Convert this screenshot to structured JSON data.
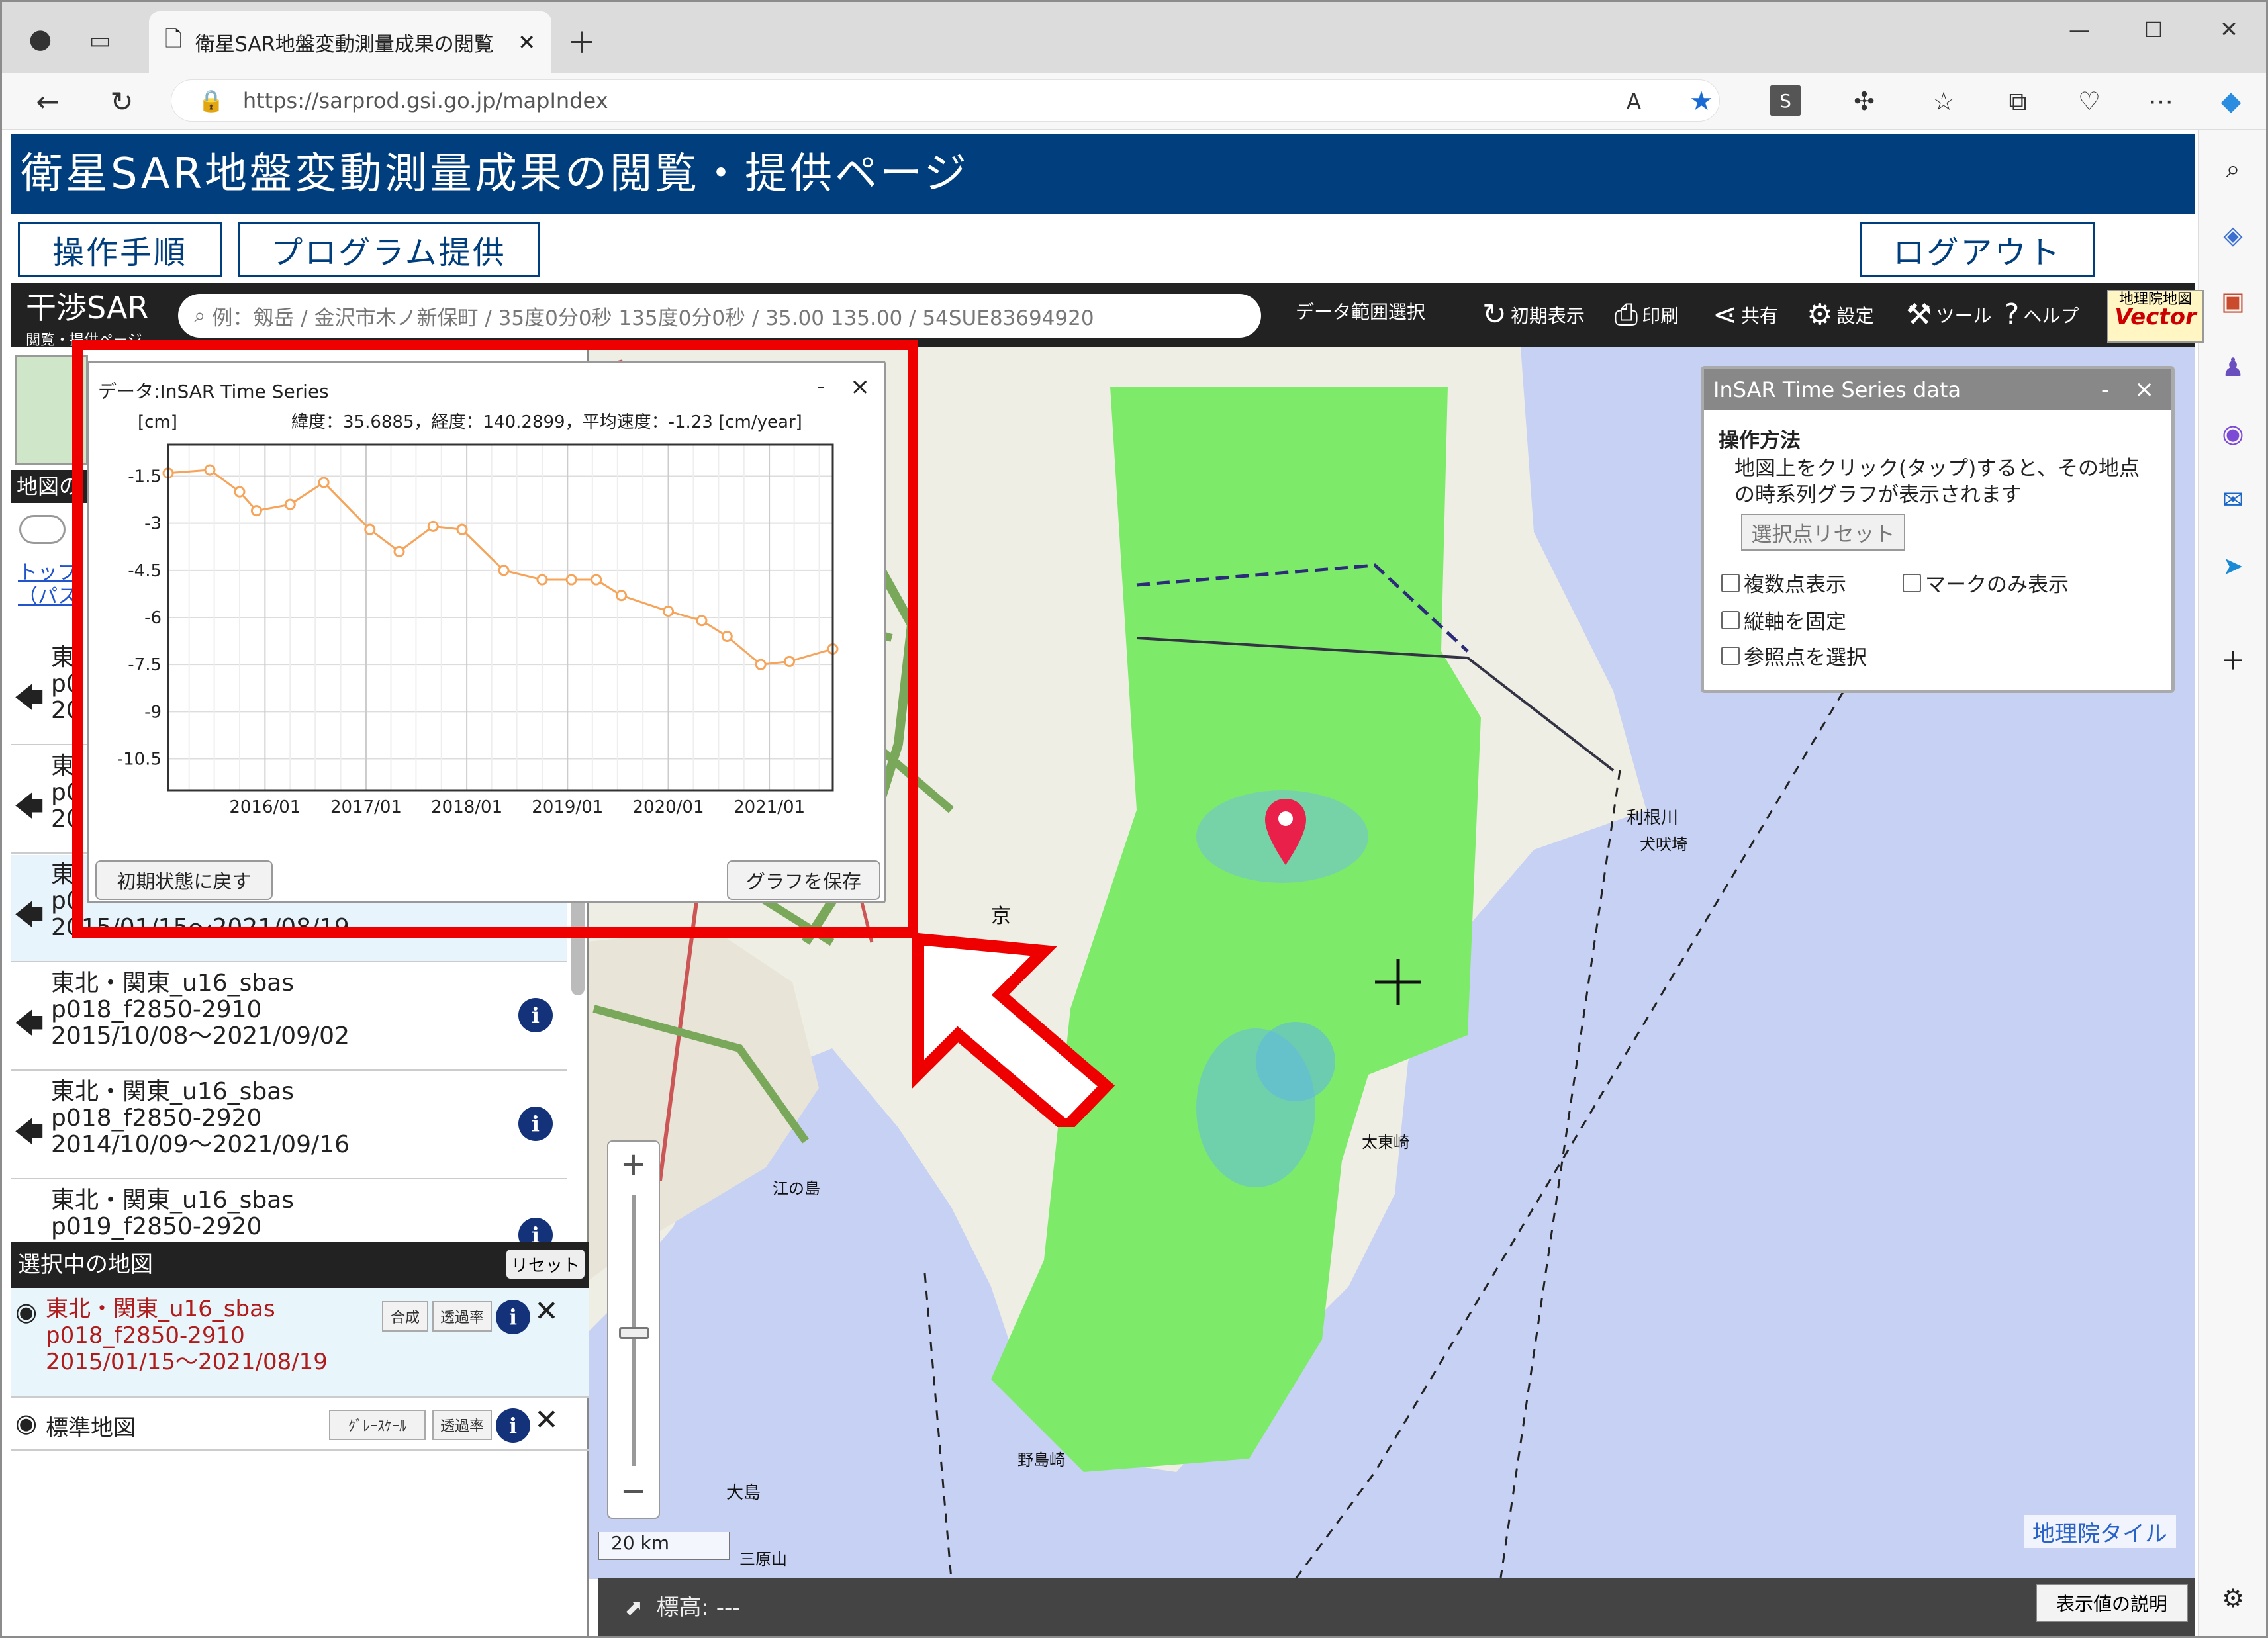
{
  "browser": {
    "tab_title": "衛星SAR地盤変動測量成果の閲覧",
    "url": "https://sarprod.gsi.go.jp/mapIndex"
  },
  "site": {
    "title": "衛星SAR地盤変動測量成果の閲覧・提供ページ",
    "nav": {
      "procedure": "操作手順",
      "program": "プログラム提供",
      "logout": "ログアウト"
    }
  },
  "mapbar": {
    "logo": "干渉SAR",
    "logo_sub": "閲覧・提供ページ",
    "search_placeholder": "例：剱岳 / 金沢市木ノ新保町 / 35度0分0秒 135度0分0秒 / 35.00 135.00 / 54SUE83694920",
    "data_range": "データ範囲選択",
    "initial": "初期表示",
    "print": "印刷",
    "share": "共有",
    "settings": "設定",
    "tools": "ツール",
    "help": "ヘルプ",
    "gsi_top": "地理院地図",
    "gsi_bottom": "Vector"
  },
  "panel": {
    "header": "地図の",
    "link1": "トップ",
    "link2": "（パス",
    "items": [
      {
        "name": "東",
        "line2": "p0",
        "line3": "20"
      },
      {
        "name": "東",
        "line2": "p0",
        "line3": "20"
      },
      {
        "name": "東",
        "line2": "p0",
        "line3": "2015/01/15～2021/08/19"
      },
      {
        "name": "東北・関東_u16_sbas",
        "line2": "p018_f2850-2910",
        "line3": "2015/10/08～2021/09/02"
      },
      {
        "name": "東北・関東_u16_sbas",
        "line2": "p018_f2850-2920",
        "line3": "2014/10/09～2021/09/16"
      },
      {
        "name": "東北・関東_u16_sbas",
        "line2": "p019_f2850-2920",
        "line3": ""
      }
    ],
    "selected_header": "選択中の地図",
    "reset": "リセット",
    "selected": [
      {
        "line1": "東北・関東_u16_sbas",
        "line2": "p018_f2850-2910",
        "line3": "2015/01/15～2021/08/19",
        "btn1": "合成",
        "btn2": "透過率"
      },
      {
        "line1": "標準地図",
        "btn1": "ｸﾞﾚｰｽｹｰﾙ",
        "btn2": "透過率"
      }
    ]
  },
  "chart_window": {
    "title": "データ:InSAR Time Series",
    "minimize": "-",
    "close": "×",
    "info": "緯度：35.6885，経度：140.2899，平均速度：-1.23 [cm/year]",
    "reset_btn": "初期状態に戻す",
    "save_btn": "グラフを保存"
  },
  "chart_data": {
    "type": "line",
    "title": "",
    "xlabel": "",
    "ylabel": "[cm]",
    "x_ticks": [
      "2016/01",
      "2017/01",
      "2018/01",
      "2019/01",
      "2020/01",
      "2021/01"
    ],
    "y_ticks": [
      "-1.5",
      "-3",
      "-4.5",
      "-6",
      "-7.5",
      "-9",
      "-10.5"
    ],
    "ylim": [
      -11.5,
      -0.5
    ],
    "xlim": [
      "2015/01/15",
      "2021/08/19"
    ],
    "series": [
      {
        "color": "#f5a45a",
        "x": [
          "2015/01/15",
          "2015/06/15",
          "2015/10/01",
          "2015/12/01",
          "2016/04/01",
          "2016/08/01",
          "2017/01/15",
          "2017/05/01",
          "2017/09/01",
          "2017/12/15",
          "2018/05/15",
          "2018/10/01",
          "2019/01/15",
          "2019/04/15",
          "2019/07/15",
          "2020/01/01",
          "2020/05/01",
          "2020/08/01",
          "2020/12/01",
          "2021/03/15",
          "2021/08/19"
        ],
        "values": [
          -1.4,
          -1.3,
          -2.0,
          -2.6,
          -2.4,
          -1.7,
          -3.2,
          -3.9,
          -3.1,
          -3.2,
          -4.5,
          -4.8,
          -4.8,
          -4.8,
          -5.3,
          -5.8,
          -6.1,
          -6.6,
          -7.5,
          -7.4,
          -7.0
        ]
      }
    ]
  },
  "insar_panel": {
    "title": "InSAR Time Series data",
    "minimize": "-",
    "close": "×",
    "howto": "操作方法",
    "desc1": "地図上をクリック(タップ)すると、その地点",
    "desc2": "の時系列グラフが表示されます",
    "reset_btn": "選択点リセット",
    "cb_multi": "複数点表示",
    "cb_mark": "マークのみ表示",
    "cb_fix": "縦軸を固定",
    "cb_ref": "参照点を選択"
  },
  "map": {
    "scale": "20 km",
    "elevation": "標高: ---",
    "explain": "表示値の説明",
    "tile_credit": "地理院タイル",
    "labels": {
      "tokyo": "京",
      "tone": "利根川",
      "inubo": "犬吠埼",
      "taito": "太東崎",
      "oshima": "大島",
      "nojima": "野島崎",
      "kanaya": "江の島",
      "izuoshima": "三原山"
    }
  }
}
